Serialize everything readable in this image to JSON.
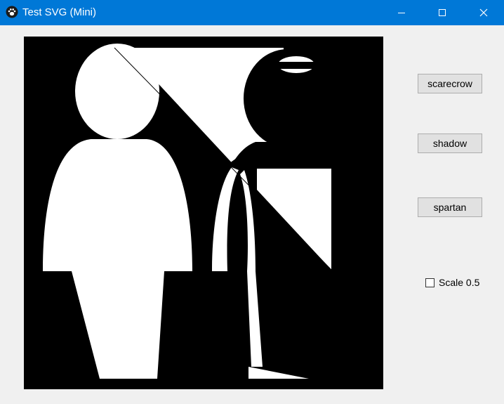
{
  "window": {
    "title": "Test SVG (Mini)",
    "titlebar_color": "#0078d7"
  },
  "icons": {
    "app": "paw-icon",
    "minimize": "minimize-icon",
    "maximize": "maximize-icon",
    "close": "close-icon"
  },
  "buttons": {
    "scarecrow": "scarecrow",
    "shadow": "shadow",
    "spartan": "spartan"
  },
  "options": {
    "scale_label": "Scale 0.5",
    "scale_checked": false
  },
  "canvas": {
    "background": "#000000",
    "foreground": "#ffffff"
  }
}
